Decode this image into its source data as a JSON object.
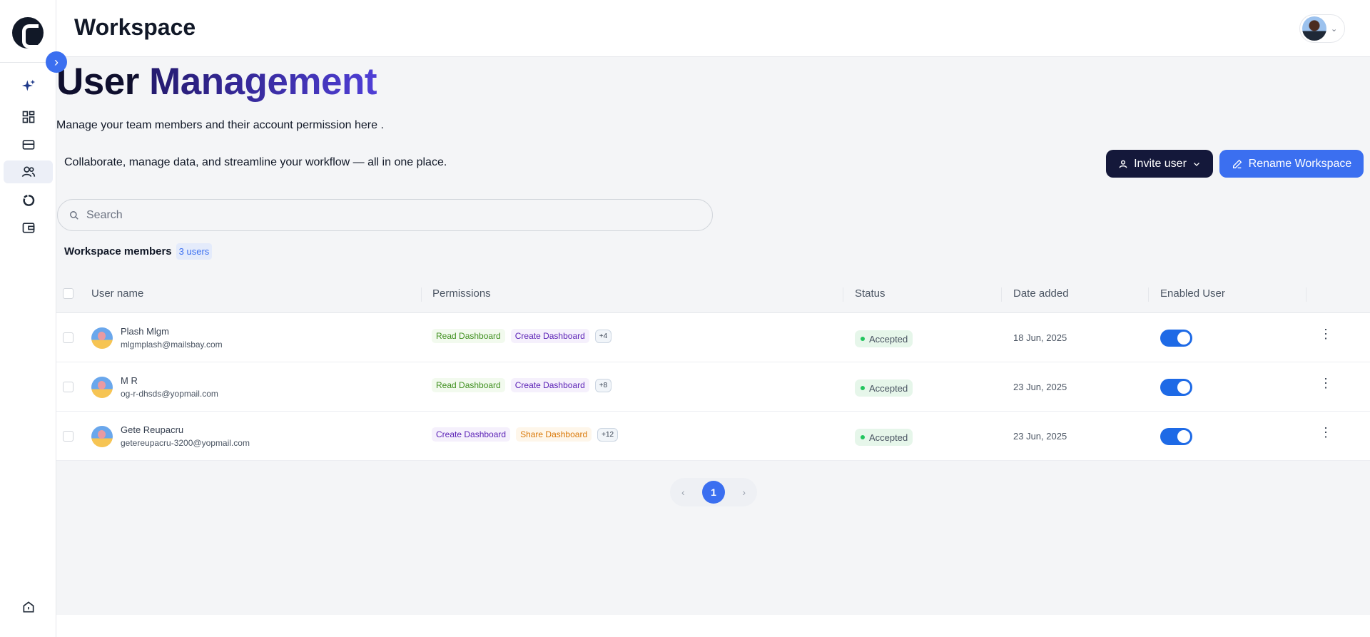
{
  "header": {
    "title": "Workspace"
  },
  "page": {
    "title_part1": "User ",
    "title_part2": "Management",
    "subtitle": "Manage your team members and their account permission here .",
    "tagline": "Collaborate, manage data, and streamline your workflow — all in one place."
  },
  "actions": {
    "invite_label": "Invite user",
    "rename_label": "Rename Workspace"
  },
  "search": {
    "placeholder": "Search"
  },
  "members": {
    "label": "Workspace members",
    "count": "3 users"
  },
  "table": {
    "headers": {
      "username": "User name",
      "permissions": "Permissions",
      "status": "Status",
      "date": "Date added",
      "enabled": "Enabled User"
    },
    "rows": [
      {
        "name": "Plash Mlgm",
        "email": "mlgmplash@mailsbay.com",
        "perms": [
          {
            "label": "Read Dashboard",
            "kind": "read"
          },
          {
            "label": "Create Dashboard",
            "kind": "create"
          }
        ],
        "more": "+4",
        "status": "Accepted",
        "date": "18 Jun, 2025",
        "enabled": true
      },
      {
        "name": "M R",
        "email": "og-r-dhsds@yopmail.com",
        "perms": [
          {
            "label": "Read Dashboard",
            "kind": "read"
          },
          {
            "label": "Create Dashboard",
            "kind": "create"
          }
        ],
        "more": "+8",
        "status": "Accepted",
        "date": "23 Jun, 2025",
        "enabled": true
      },
      {
        "name": "Gete Reupacru",
        "email": "getereupacru-3200@yopmail.com",
        "perms": [
          {
            "label": "Create Dashboard",
            "kind": "create"
          },
          {
            "label": "Share Dashboard",
            "kind": "share"
          }
        ],
        "more": "+12",
        "status": "Accepted",
        "date": "23 Jun, 2025",
        "enabled": true
      }
    ]
  },
  "pagination": {
    "current": "1",
    "prev": "‹",
    "next": "›"
  },
  "colors": {
    "accent": "#3b6ff0",
    "navy": "#14183a",
    "status_green": "#22c55e"
  },
  "sidebar": {
    "items": [
      {
        "name": "sparkle-icon"
      },
      {
        "name": "dashboard-grid-icon"
      },
      {
        "name": "card-icon"
      },
      {
        "name": "users-icon",
        "active": true
      },
      {
        "name": "donut-chart-icon"
      },
      {
        "name": "wallet-icon"
      },
      {
        "name": "home-icon"
      }
    ]
  }
}
